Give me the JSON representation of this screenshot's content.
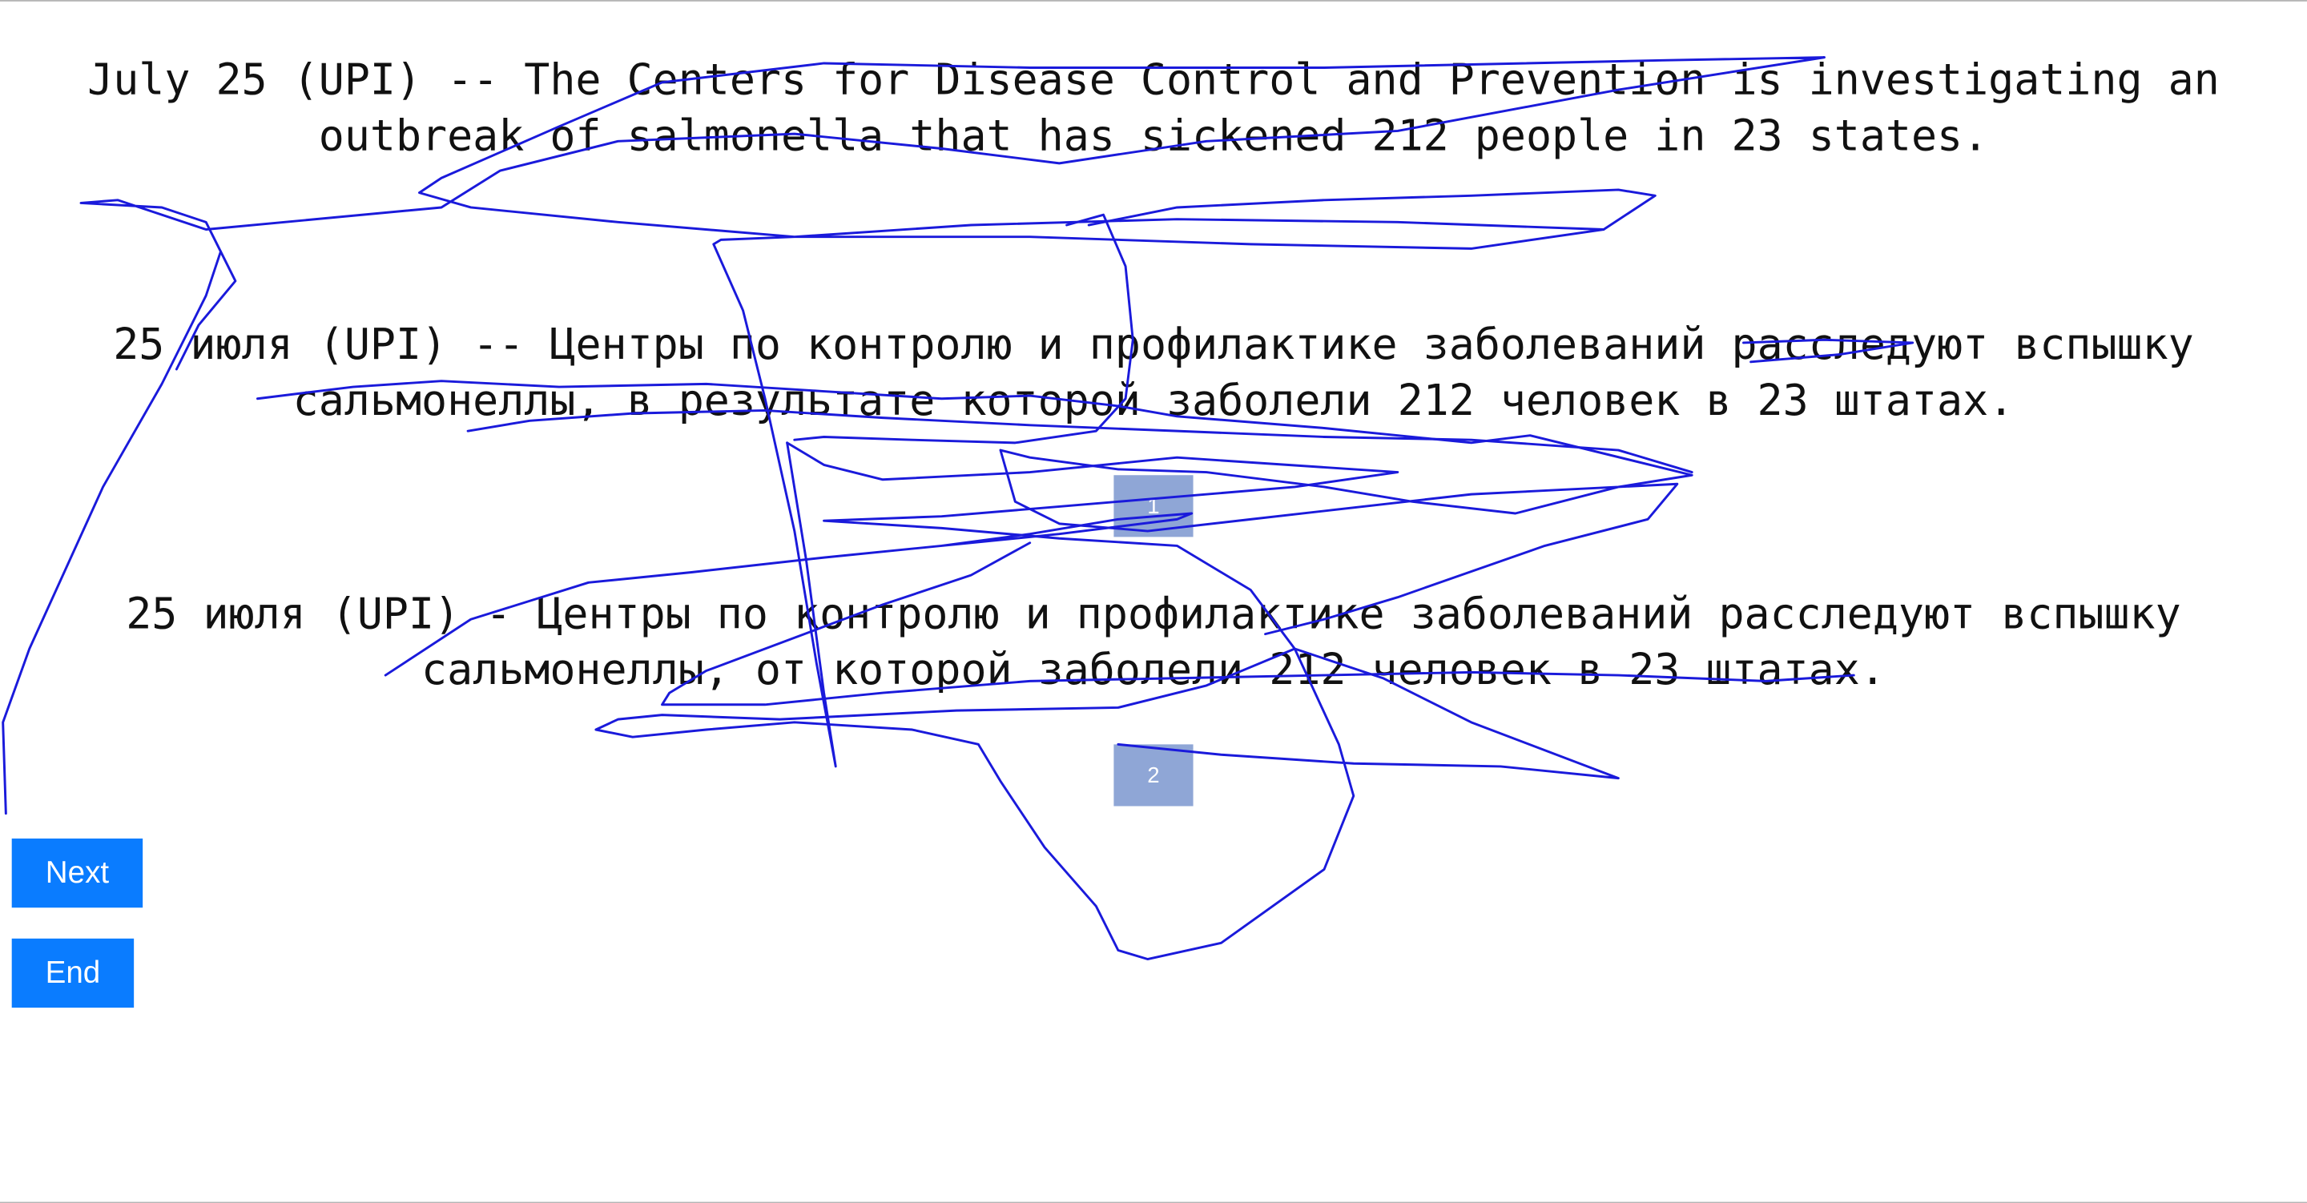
{
  "source": {
    "text": "July 25 (UPI) -- The Centers for Disease Control and Prevention is investigating an outbreak of salmonella that has sickened 212 people in 23 states."
  },
  "translations": [
    {
      "text": "25 июля (UPI) -- Центры по контролю и профилактике заболеваний расследуют вспышку сальмонеллы, в результате которой заболели 212 человек в 23 штатах.",
      "badge": "1"
    },
    {
      "text": "25 июля (UPI) - Центры по контролю и профилактике заболеваний расследуют вспышку сальмонеллы, от которой заболели 212 человек в 23 штатах.",
      "badge": "2"
    }
  ],
  "buttons": {
    "next_label": "Next",
    "end_label": "End"
  },
  "colors": {
    "button_bg": "#0a7cff",
    "badge_bg": "#8fa6d6",
    "scribble_stroke": "#1a1adb"
  }
}
